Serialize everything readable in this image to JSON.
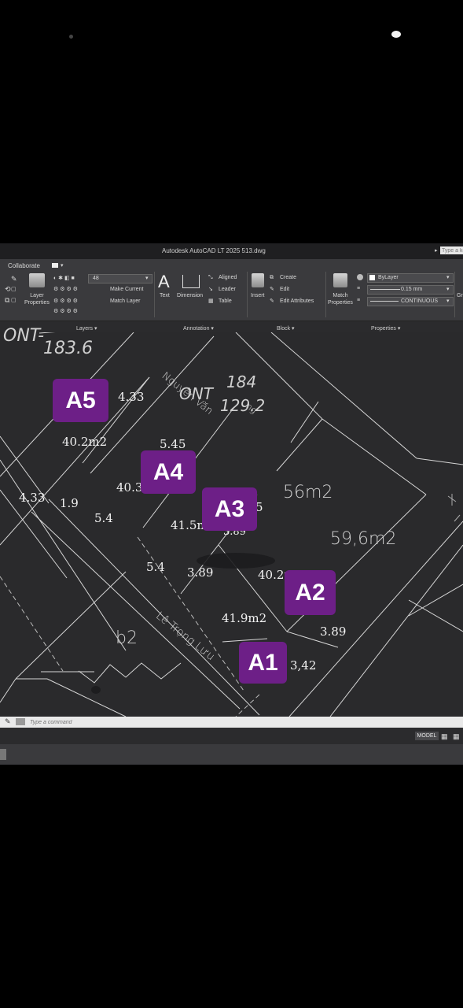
{
  "titlebar": {
    "title": "Autodesk AutoCAD LT 2025   513.dwg",
    "search_placeholder": "Type a ke"
  },
  "ribbon": {
    "collaborate_label": "Collaborate",
    "layers": {
      "layer_properties": "Layer\nProperties",
      "layer_value": "48",
      "make_current": "Make Current",
      "match_layer": "Match Layer",
      "panel_title": "Layers ▾"
    },
    "annotation": {
      "text": "Text",
      "dimension": "Dimension",
      "aligned": "Aligned",
      "leader": "Leader",
      "table": "Table",
      "panel_title": "Annotation ▾"
    },
    "block": {
      "insert": "Insert",
      "create": "Create",
      "edit": "Edit",
      "edit_attributes": "Edit Attributes",
      "panel_title": "Block ▾"
    },
    "properties": {
      "match_properties": "Match\nProperties",
      "color_value": "ByLayer",
      "lineweight_value": "0.15 mm",
      "linetype_value": "CONTINUOUS",
      "panel_title": "Properties ▾",
      "cut_label": "Gr"
    }
  },
  "drawing": {
    "texts": {
      "ont_top_left": "ONT-",
      "area_top_left": "183.6",
      "ont_right": "ONT",
      "num_184": "184",
      "area_129": "129.2",
      "street_name": "Nguyễn Văn",
      "street_suffix": "ng",
      "area_56": "56m2",
      "area_59": "59,6m2",
      "label_b2": "b2",
      "street_bottom": "Lê Trọng Lưu"
    },
    "dimensions": {
      "d_4_33_top": "4.33",
      "d_40_2m2": "40.2m2",
      "d_5_45": "5.45",
      "d_40_3": "40.3",
      "d_4_33_left": "4.33",
      "d_1_9": "1.9",
      "d_5_4_a": "5.4",
      "d_41_5m": "41.5m",
      "d_3_89_a": "3.89",
      "d_5_4_b": "5.4",
      "d_3_89_b": "3.89",
      "d_40_2m": "40.2m",
      "d_41_9m2": "41.9m2",
      "d_3_89_c": "3.89",
      "d_3_42": "3,42",
      "d_5_fragment": "5"
    },
    "tags": {
      "a1": "A1",
      "a2": "A2",
      "a3": "A3",
      "a4": "A4",
      "a5": "A5"
    },
    "tag_color": "#6d1f87"
  },
  "command": {
    "placeholder": "Type a command"
  },
  "status": {
    "model": "MODEL"
  }
}
